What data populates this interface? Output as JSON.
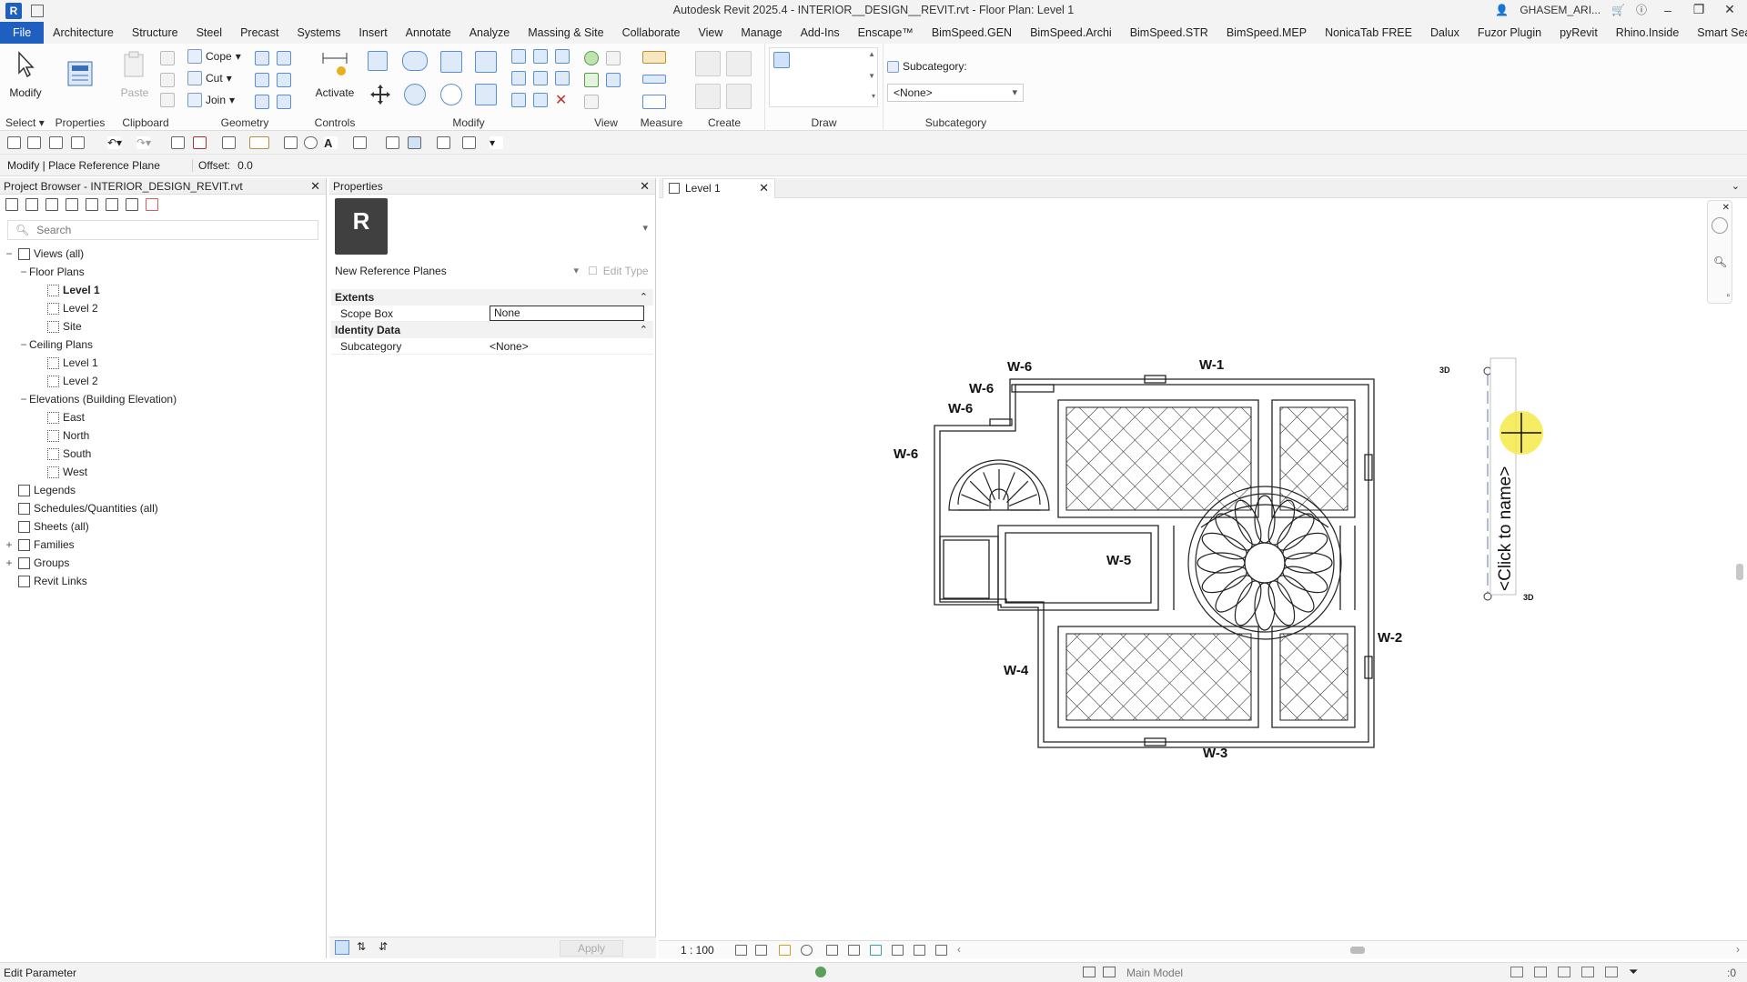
{
  "window": {
    "title": "Autodesk Revit 2025.4 - INTERIOR__DESIGN__REVIT.rvt - Floor Plan: Level 1",
    "user": "GHASEM_ARI..."
  },
  "menu_tabs": [
    "File",
    "Architecture",
    "Structure",
    "Steel",
    "Precast",
    "Systems",
    "Insert",
    "Annotate",
    "Analyze",
    "Massing & Site",
    "Collaborate",
    "View",
    "Manage",
    "Add-Ins",
    "Enscape™",
    "BimSpeed.GEN",
    "BimSpeed.Archi",
    "BimSpeed.STR",
    "BimSpeed.MEP",
    "NonicaTab FREE",
    "Dalux",
    "Fuzor Plugin",
    "pyRevit",
    "Rhino.Inside",
    "Smart Search"
  ],
  "ribbon": {
    "modify_label": "Modify",
    "paste_label": "Paste",
    "cope_label": "Cope",
    "cut_label": "Cut",
    "join_label": "Join",
    "activate_label": "Activate",
    "panels": {
      "select": "Select",
      "properties": "Properties",
      "clipboard": "Clipboard",
      "geometry": "Geometry",
      "controls": "Controls",
      "modify": "Modify",
      "view": "View",
      "measure": "Measure",
      "create": "Create",
      "draw": "Draw",
      "subcategory": "Subcategory"
    },
    "subcategory_label": "Subcategory:",
    "subcategory_value": "<None>"
  },
  "options_bar": {
    "context": "Modify | Place Reference Plane",
    "offset_label": "Offset:",
    "offset_value": "0.0"
  },
  "project_browser": {
    "title": "Project Browser - INTERIOR_DESIGN_REVIT.rvt",
    "search_placeholder": "Search",
    "items": [
      {
        "label": "Views (all)",
        "toggle": "−",
        "depth": 0
      },
      {
        "label": "Floor Plans",
        "toggle": "−",
        "depth": 1
      },
      {
        "label": "Level 1",
        "toggle": "",
        "depth": 2,
        "bold": true
      },
      {
        "label": "Level 2",
        "toggle": "",
        "depth": 2
      },
      {
        "label": "Site",
        "toggle": "",
        "depth": 2
      },
      {
        "label": "Ceiling Plans",
        "toggle": "−",
        "depth": 1
      },
      {
        "label": "Level 1",
        "toggle": "",
        "depth": 2
      },
      {
        "label": "Level 2",
        "toggle": "",
        "depth": 2
      },
      {
        "label": "Elevations (Building Elevation)",
        "toggle": "−",
        "depth": 1
      },
      {
        "label": "East",
        "toggle": "",
        "depth": 2
      },
      {
        "label": "North",
        "toggle": "",
        "depth": 2
      },
      {
        "label": "South",
        "toggle": "",
        "depth": 2
      },
      {
        "label": "West",
        "toggle": "",
        "depth": 2
      },
      {
        "label": "Legends",
        "toggle": "",
        "depth": 0
      },
      {
        "label": "Schedules/Quantities (all)",
        "toggle": "",
        "depth": 0
      },
      {
        "label": "Sheets (all)",
        "toggle": "",
        "depth": 0
      },
      {
        "label": "Families",
        "toggle": "+",
        "depth": 0
      },
      {
        "label": "Groups",
        "toggle": "+",
        "depth": 0
      },
      {
        "label": "Revit Links",
        "toggle": "",
        "depth": 0
      }
    ]
  },
  "properties": {
    "title": "Properties",
    "type_icon_letter": "R",
    "type_selector": "New Reference Planes",
    "edit_type": "Edit Type",
    "groups": {
      "extents": "Extents",
      "identity": "Identity Data"
    },
    "rows": {
      "scope_box_name": "Scope Box",
      "scope_box_value": "None",
      "subcategory_name": "Subcategory",
      "subcategory_value": "<None>"
    },
    "apply": "Apply"
  },
  "view": {
    "tab_label": "Level 1",
    "scale": "1 : 100",
    "wall_labels": [
      "W-1",
      "W-2",
      "W-3",
      "W-4",
      "W-5",
      "W-6",
      "W-6",
      "W-6",
      "W-6"
    ],
    "reference_plane_label": "<Click to name>",
    "marker_3d": "3D"
  },
  "status_bar": {
    "text": "Edit Parameter",
    "workset": "Main Model",
    "filter_count": ":0"
  }
}
